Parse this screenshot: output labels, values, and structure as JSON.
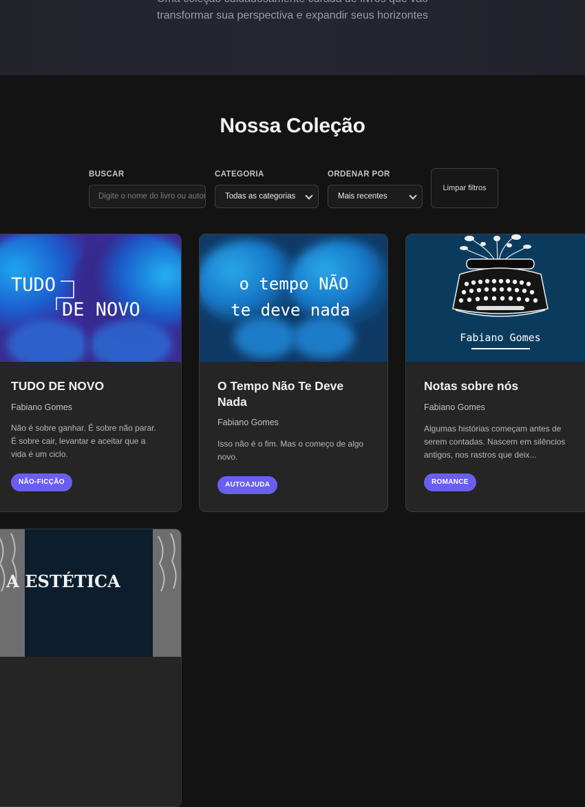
{
  "hero": {
    "line1": "Uma coleção cuidadosamente curada de livros que vão",
    "line2": "transformar sua perspectiva e expandir seus horizontes"
  },
  "collection": {
    "title": "Nossa Coleção"
  },
  "filters": {
    "search": {
      "label": "BUSCAR",
      "placeholder": "Digite o nome do livro ou autor"
    },
    "category": {
      "label": "CATEGORIA",
      "selected": "Todas as categorias"
    },
    "sort": {
      "label": "ORDENAR POR",
      "selected": "Mais recentes"
    },
    "clear_label": "Limpar filtros"
  },
  "books": [
    {
      "title": "TUDO DE NOVO",
      "author": "Fabiano Gomes",
      "description": [
        "Não é sobre ganhar. É sobre não parar.",
        "É sobre cair, levantar e aceitar que a",
        "vida é um ciclo."
      ],
      "category": "NÃO-FICÇÃO",
      "cover_text": [
        "TUDO",
        "DE NOVO"
      ]
    },
    {
      "title": "O Tempo Não Te Deve Nada",
      "author": "Fabiano Gomes",
      "description": [
        "Isso não é o fim. Mas o começo de algo",
        "novo."
      ],
      "category": "AUTOAJUDA",
      "cover_text": [
        "o tempo NÃO",
        "te deve nada"
      ]
    },
    {
      "title": "Notas sobre nós",
      "author": "Fabiano Gomes",
      "description": [
        "Algumas histórias começam antes de",
        "serem contadas. Nascem em silêncios",
        "antigos, nos rastros que deix..."
      ],
      "category": "ROMANCE",
      "cover_text": [
        "Fabiano Gomes"
      ]
    },
    {
      "cover_text": [
        "A ESTÉTICA"
      ]
    }
  ],
  "colors": {
    "accent": "#6a5ef0",
    "background": "#131313",
    "card": "#252525"
  }
}
